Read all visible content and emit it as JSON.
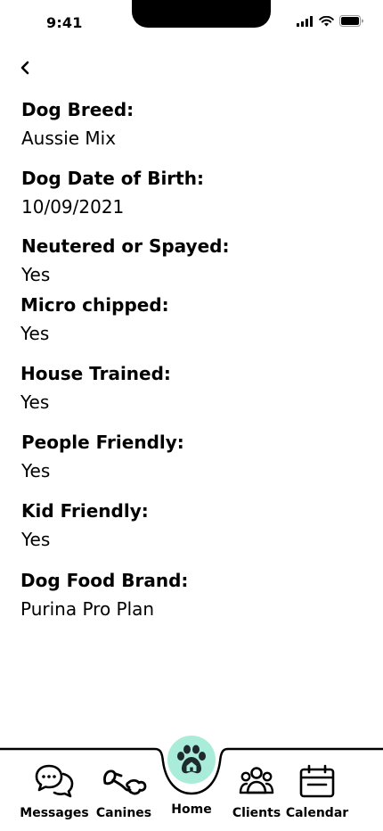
{
  "status": {
    "time": "9:41"
  },
  "fields": [
    {
      "label": "Dog Breed:",
      "value": "Aussie Mix"
    },
    {
      "label": "Dog Date of Birth:",
      "value": "10/09/2021"
    },
    {
      "label": "Neutered or Spayed:",
      "value": "Yes"
    },
    {
      "label": "Micro chipped:",
      "value": "Yes"
    },
    {
      "label": "House Trained:",
      "value": "Yes"
    },
    {
      "label": "People Friendly:",
      "value": "Yes"
    },
    {
      "label": "Kid Friendly:",
      "value": "Yes"
    },
    {
      "label": "Dog Food Brand:",
      "value": "Purina Pro Plan"
    }
  ],
  "nav": {
    "messages": "Messages",
    "canines": "Canines",
    "home": "Home",
    "clients": "Clients",
    "calendar": "Calendar"
  },
  "colors": {
    "home_accent": "#a9ecd9"
  },
  "icons": {
    "back": "chevron-left-icon",
    "messages": "chat-bubbles-icon",
    "canines": "dog-bone-icon",
    "home": "paw-home-icon",
    "clients": "people-icon",
    "calendar": "calendar-icon"
  }
}
